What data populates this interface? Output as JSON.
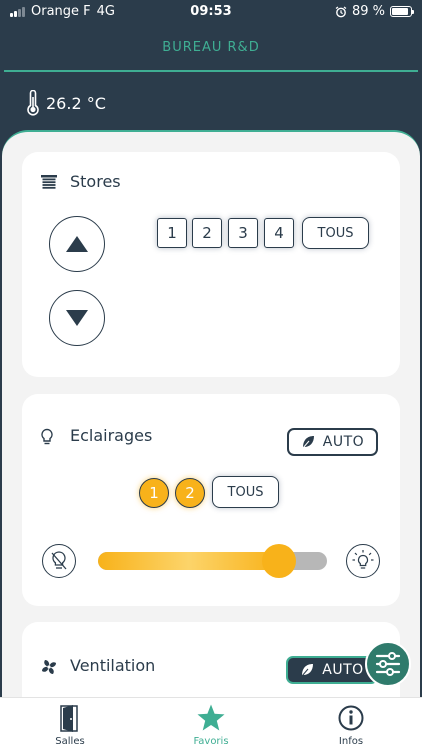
{
  "status_bar": {
    "carrier": "Orange F",
    "network": "4G",
    "time": "09:53",
    "battery": "89 %"
  },
  "header": {
    "room_title": "BUREAU R&D",
    "temperature": "26.2 °C"
  },
  "stores": {
    "title": "Stores",
    "buttons": [
      "1",
      "2",
      "3",
      "4"
    ],
    "all_label": "TOUS"
  },
  "eclairages": {
    "title": "Eclairages",
    "auto_label": "AUTO",
    "lights": [
      "1",
      "2"
    ],
    "all_label": "TOUS",
    "brightness_fraction": 0.79
  },
  "ventilation": {
    "title": "Ventilation",
    "auto_label": "AUTO"
  },
  "tabs": [
    {
      "label": "Salles",
      "icon": "door-icon"
    },
    {
      "label": "Favoris",
      "icon": "star-icon"
    },
    {
      "label": "Infos",
      "icon": "info-icon"
    }
  ],
  "colors": {
    "navy": "#2b3c4b",
    "accent": "#3fae93",
    "amber": "#f8b21a"
  }
}
